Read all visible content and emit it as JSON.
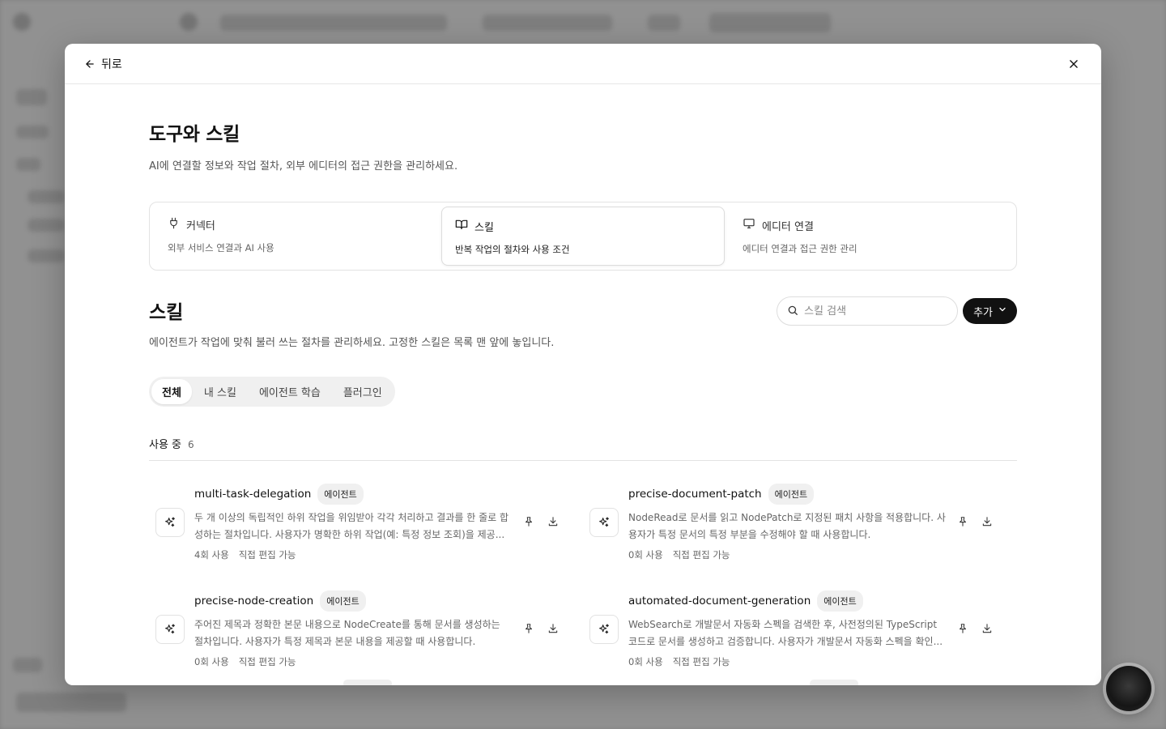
{
  "header": {
    "back_label": "뒤로"
  },
  "page": {
    "title": "도구와 스킬",
    "description": "AI에 연결할 정보와 작업 절차, 외부 에디터의 접근 권한을 관리하세요."
  },
  "categories": [
    {
      "title": "커넥터",
      "subtitle": "외부 서비스 연결과 AI 사용",
      "icon": "plug-icon"
    },
    {
      "title": "스킬",
      "subtitle": "반복 작업의 절차와 사용 조건",
      "icon": "book-icon"
    },
    {
      "title": "에디터 연결",
      "subtitle": "에디터 연결과 접근 권한 관리",
      "icon": "monitor-icon"
    }
  ],
  "section": {
    "title": "스킬",
    "description": "에이전트가 작업에 맞춰 불러 쓰는 절차를 관리하세요. 고정한 스킬은 목록 맨 앞에 놓입니다.",
    "search_placeholder": "스킬 검색",
    "add_label": "추가"
  },
  "tabs": [
    "전체",
    "내 스킬",
    "에이전트 학습",
    "플러그인"
  ],
  "group": {
    "title": "사용 중",
    "count": "6"
  },
  "skills": [
    {
      "name": "multi-task-delegation",
      "badge": "에이전트",
      "description": "두 개 이상의 독립적인 하위 작업을 위임받아 각각 처리하고 결과를 한 줄로 합성하는 절차입니다. 사용자가 명확한 하위 작업(예: 특정 정보 조회)을 제공...",
      "usage": "4회 사용",
      "edit": "직접 편집 가능"
    },
    {
      "name": "precise-document-patch",
      "badge": "에이전트",
      "description": "NodeRead로 문서를 읽고 NodePatch로 지정된 패치 사항을 적용합니다. 사용자가 특정 문서의 특정 부분을 수정해야 할 때 사용합니다.",
      "usage": "0회 사용",
      "edit": "직접 편집 가능"
    },
    {
      "name": "precise-node-creation",
      "badge": "에이전트",
      "description": "주어진 제목과 정확한 본문 내용으로 NodeCreate를 통해 문서를 생성하는 절차입니다. 사용자가 특정 제목과 본문 내용을 제공할 때 사용합니다.",
      "usage": "0회 사용",
      "edit": "직접 편집 가능"
    },
    {
      "name": "automated-document-generation",
      "badge": "에이전트",
      "description": "WebSearch로 개발문서 자동화 스펙을 검색한 후, 사전정의된 TypeScript 코드로 문서를 생성하고 검증합니다. 사용자가 개발문서 자동화 스펙을 확인...",
      "usage": "0회 사용",
      "edit": "직접 편집 가능"
    }
  ]
}
